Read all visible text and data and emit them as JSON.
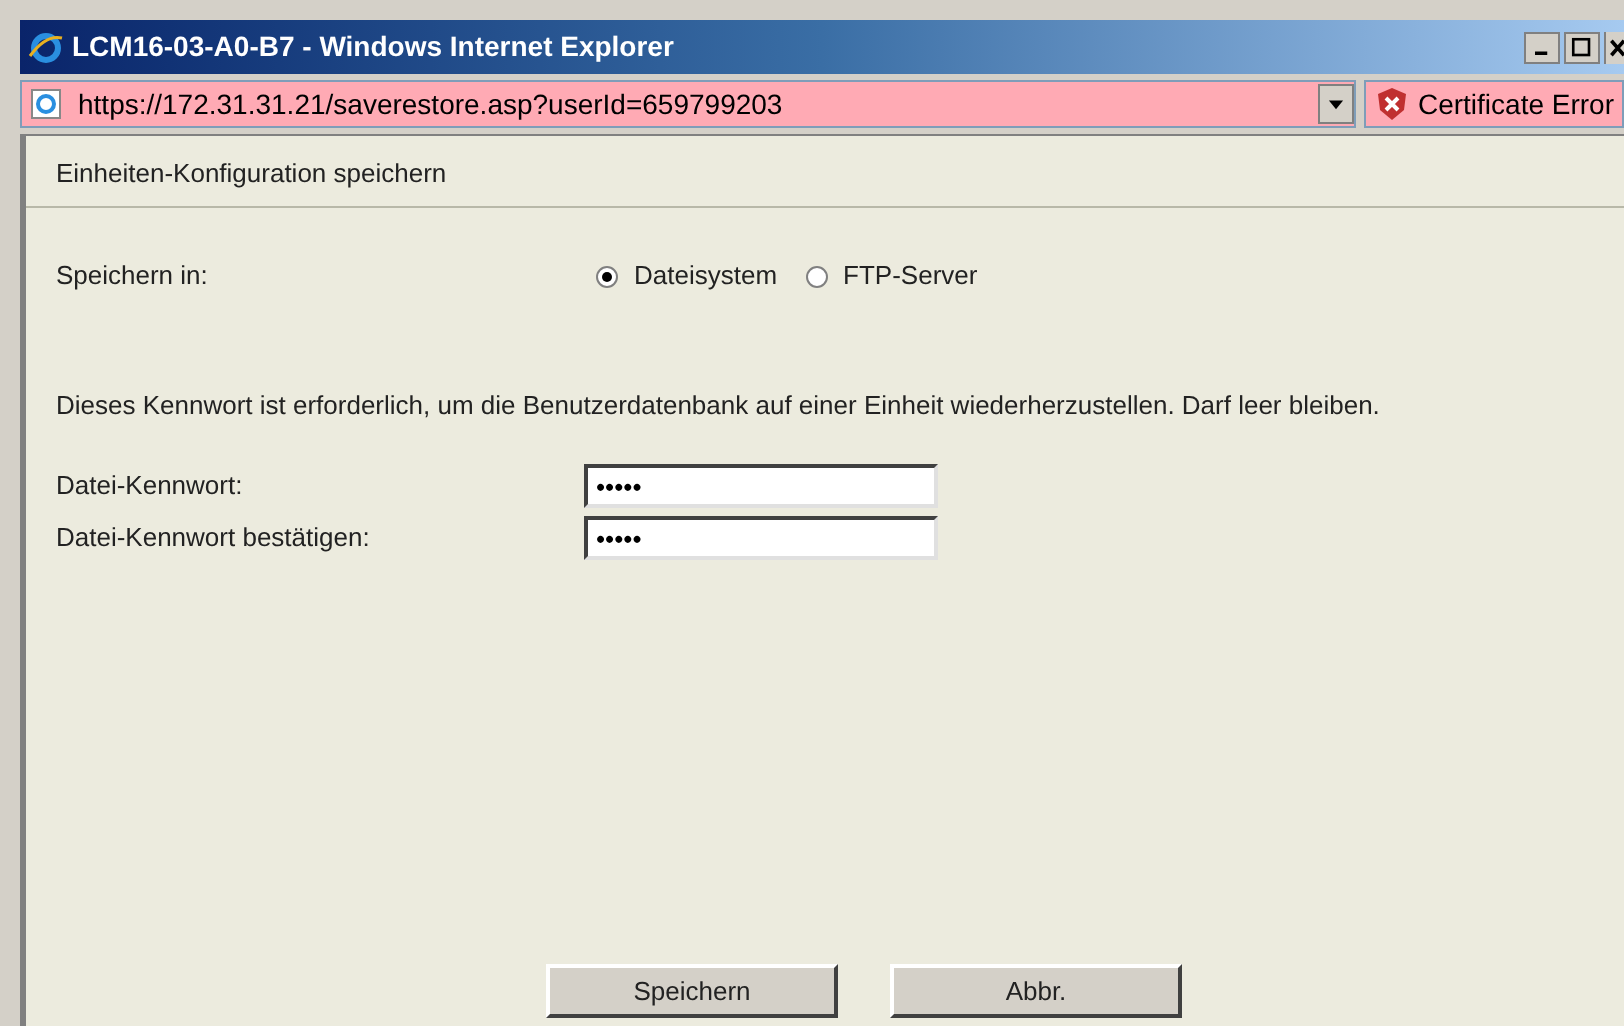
{
  "window": {
    "title": "LCM16-03-A0-B7 - Windows Internet Explorer"
  },
  "address_bar": {
    "url": "https://172.31.31.21/saverestore.asp?userId=659799203",
    "certificate_error": "Certificate Error"
  },
  "page": {
    "heading": "Einheiten-Konfiguration speichern",
    "save_to": {
      "label": "Speichern in:",
      "options": [
        {
          "label": "Dateisystem",
          "selected": true
        },
        {
          "label": "FTP-Server",
          "selected": false
        }
      ]
    },
    "description": "Dieses Kennwort ist erforderlich, um die Benutzerdatenbank auf einer Einheit wiederherzustellen. Darf leer bleiben.",
    "fields": [
      {
        "label": "Datei-Kennwort:",
        "value": "•••••"
      },
      {
        "label": "Datei-Kennwort bestätigen:",
        "value": "•••••"
      }
    ],
    "buttons": [
      "Speichern",
      "Abbr."
    ]
  }
}
